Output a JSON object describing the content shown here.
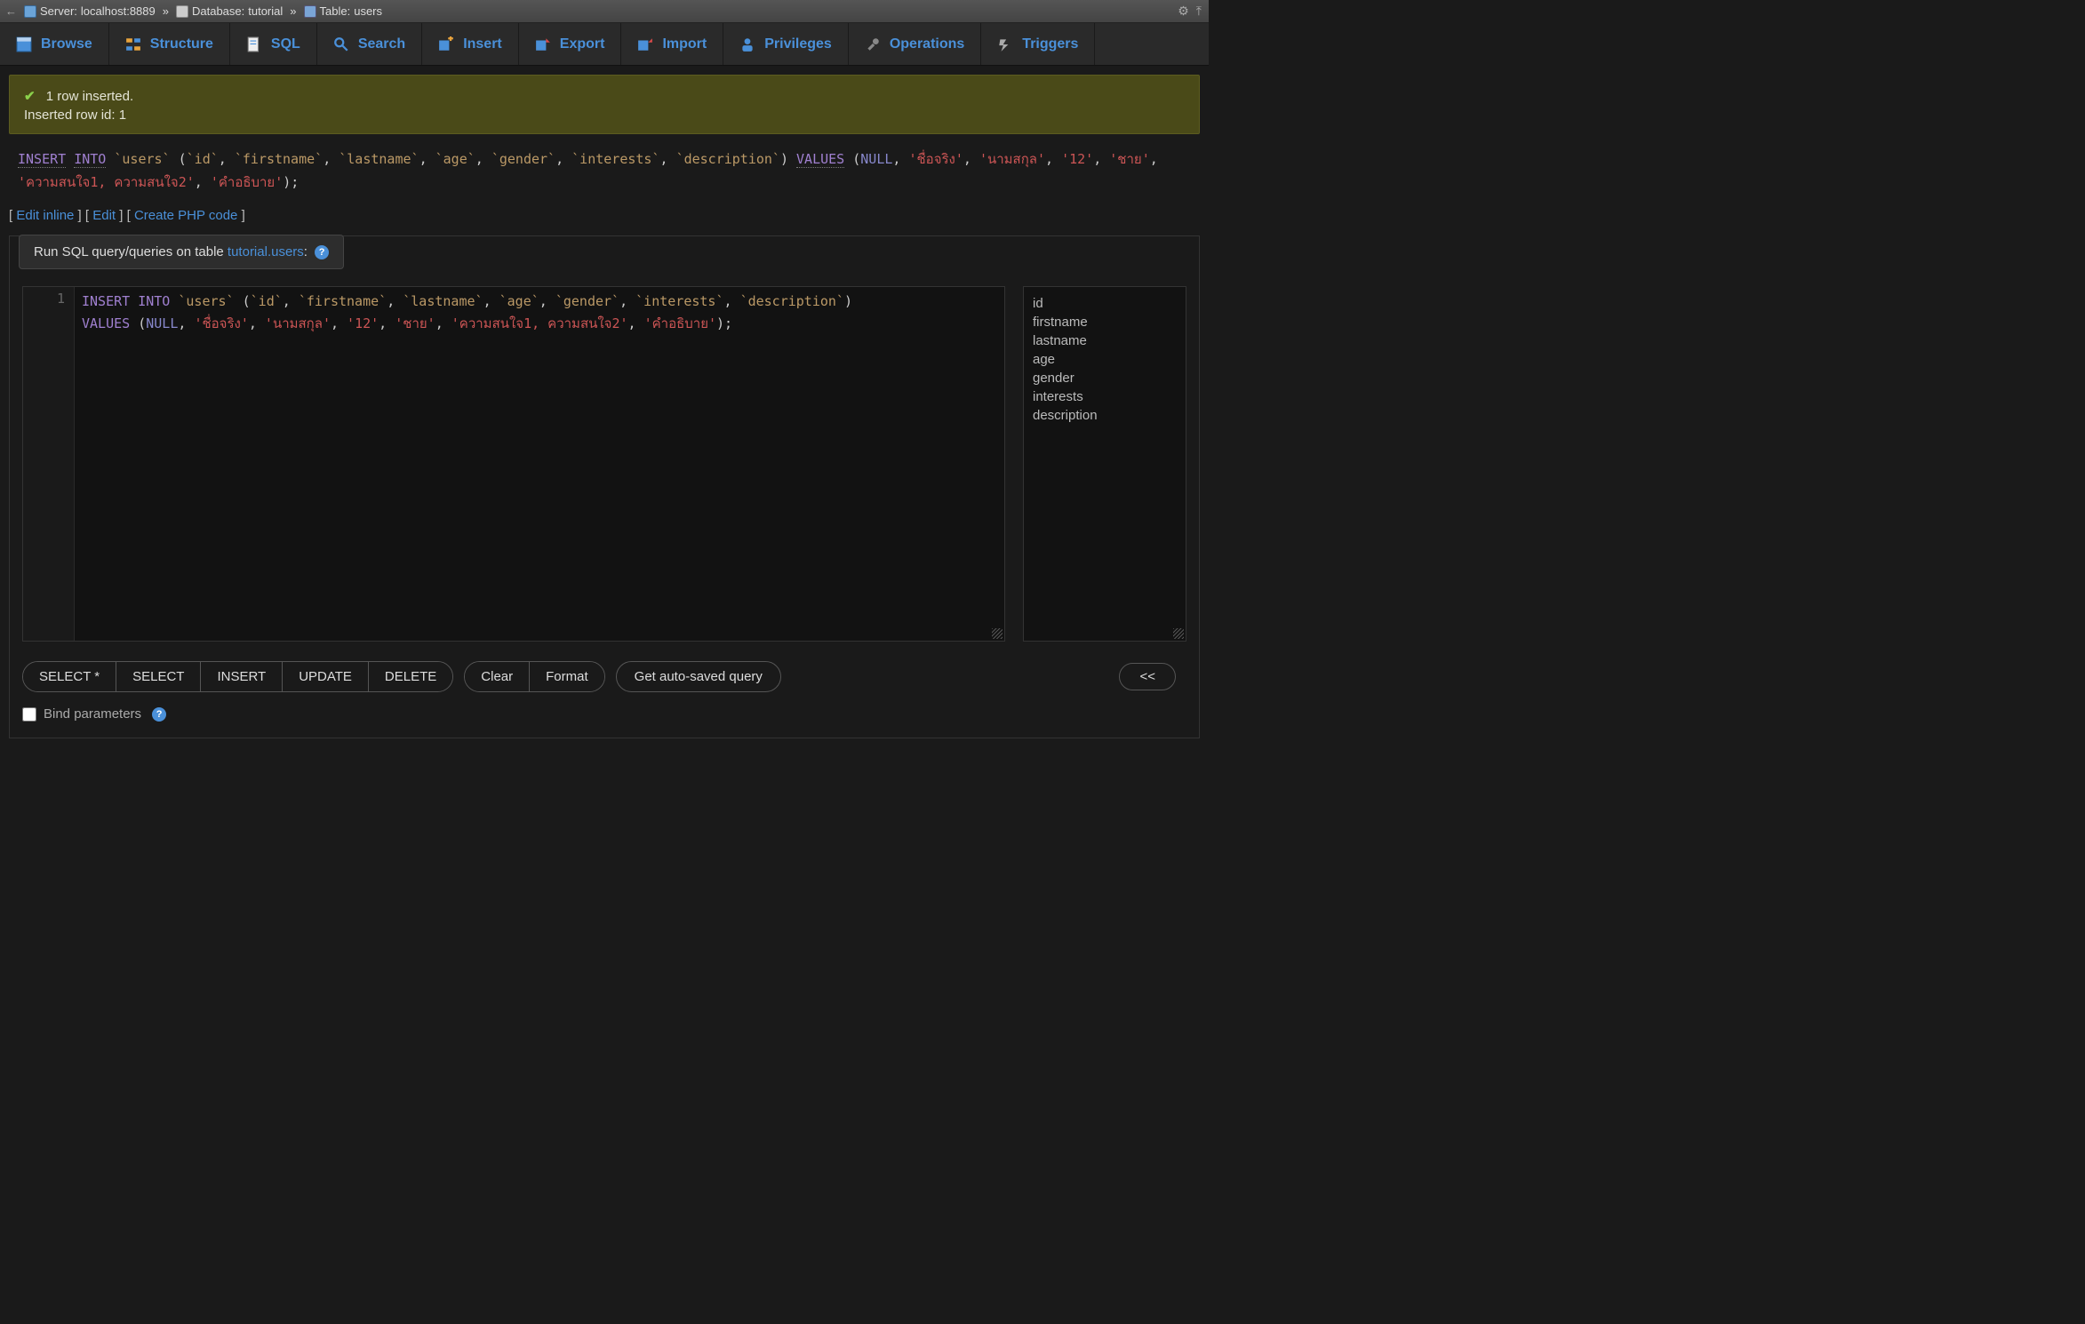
{
  "breadcrumb": {
    "server_label": "Server:",
    "server_value": "localhost:8889",
    "database_label": "Database:",
    "database_value": "tutorial",
    "table_label": "Table:",
    "table_value": "users"
  },
  "tabs": {
    "browse": "Browse",
    "structure": "Structure",
    "sql": "SQL",
    "search": "Search",
    "insert": "Insert",
    "export": "Export",
    "import": "Import",
    "privileges": "Privileges",
    "operations": "Operations",
    "triggers": "Triggers"
  },
  "notice": {
    "line1": "1 row inserted.",
    "line2": "Inserted row id: 1"
  },
  "executed_sql": {
    "tokens": [
      {
        "t": "kw-d",
        "v": "INSERT"
      },
      {
        "t": "sp",
        "v": " "
      },
      {
        "t": "kw-d",
        "v": "INTO"
      },
      {
        "t": "sp",
        "v": " "
      },
      {
        "t": "bt",
        "v": "`users`"
      },
      {
        "t": "sp",
        "v": " "
      },
      {
        "t": "p",
        "v": "("
      },
      {
        "t": "bt",
        "v": "`id`"
      },
      {
        "t": "p",
        "v": ", "
      },
      {
        "t": "bt",
        "v": "`firstname`"
      },
      {
        "t": "p",
        "v": ", "
      },
      {
        "t": "bt",
        "v": "`lastname`"
      },
      {
        "t": "p",
        "v": ", "
      },
      {
        "t": "bt",
        "v": "`age`"
      },
      {
        "t": "p",
        "v": ", "
      },
      {
        "t": "bt",
        "v": "`gender`"
      },
      {
        "t": "p",
        "v": ", "
      },
      {
        "t": "bt",
        "v": "`interests`"
      },
      {
        "t": "p",
        "v": ", "
      },
      {
        "t": "bt",
        "v": "`description`"
      },
      {
        "t": "p",
        "v": ") "
      },
      {
        "t": "kw-d",
        "v": "VALUES"
      },
      {
        "t": "sp",
        "v": " "
      },
      {
        "t": "p",
        "v": "("
      },
      {
        "t": "null",
        "v": "NULL"
      },
      {
        "t": "p",
        "v": ", "
      },
      {
        "t": "str",
        "v": "'ชื่อจริง'"
      },
      {
        "t": "p",
        "v": ", "
      },
      {
        "t": "str",
        "v": "'นามสกุล'"
      },
      {
        "t": "p",
        "v": ", "
      },
      {
        "t": "str",
        "v": "'12'"
      },
      {
        "t": "p",
        "v": ", "
      },
      {
        "t": "str",
        "v": "'ชาย'"
      },
      {
        "t": "p",
        "v": ", "
      },
      {
        "t": "str",
        "v": "'ความสนใจ1, ความสนใจ2'"
      },
      {
        "t": "p",
        "v": ", "
      },
      {
        "t": "str",
        "v": "'คำอธิบาย'"
      },
      {
        "t": "p",
        "v": ");"
      }
    ]
  },
  "action_links": {
    "edit_inline": "Edit inline",
    "edit": "Edit",
    "create_php": "Create PHP code"
  },
  "query_panel": {
    "header_prefix": "Run SQL query/queries on table ",
    "header_target": "tutorial.users",
    "header_suffix": ":"
  },
  "editor": {
    "line_no": "1",
    "tokens": [
      {
        "t": "kw",
        "v": "INSERT"
      },
      {
        "t": "sp",
        "v": " "
      },
      {
        "t": "kw",
        "v": "INTO"
      },
      {
        "t": "sp",
        "v": " "
      },
      {
        "t": "bt",
        "v": "`users`"
      },
      {
        "t": "sp",
        "v": " "
      },
      {
        "t": "p",
        "v": "("
      },
      {
        "t": "bt",
        "v": "`id`"
      },
      {
        "t": "p",
        "v": ", "
      },
      {
        "t": "bt",
        "v": "`firstname`"
      },
      {
        "t": "p",
        "v": ", "
      },
      {
        "t": "bt",
        "v": "`lastname`"
      },
      {
        "t": "p",
        "v": ", "
      },
      {
        "t": "bt",
        "v": "`age`"
      },
      {
        "t": "p",
        "v": ", "
      },
      {
        "t": "bt",
        "v": "`gender`"
      },
      {
        "t": "p",
        "v": ", "
      },
      {
        "t": "bt",
        "v": "`interests`"
      },
      {
        "t": "p",
        "v": ", "
      },
      {
        "t": "bt",
        "v": "`description`"
      },
      {
        "t": "p",
        "v": ") "
      },
      {
        "t": "nl",
        "v": "\n"
      },
      {
        "t": "kw",
        "v": "VALUES"
      },
      {
        "t": "sp",
        "v": " "
      },
      {
        "t": "p",
        "v": "("
      },
      {
        "t": "null",
        "v": "NULL"
      },
      {
        "t": "p",
        "v": ", "
      },
      {
        "t": "str",
        "v": "'ชื่อจริง'"
      },
      {
        "t": "p",
        "v": ", "
      },
      {
        "t": "str",
        "v": "'นามสกุล'"
      },
      {
        "t": "p",
        "v": ", "
      },
      {
        "t": "str",
        "v": "'12'"
      },
      {
        "t": "p",
        "v": ", "
      },
      {
        "t": "str",
        "v": "'ชาย'"
      },
      {
        "t": "p",
        "v": ", "
      },
      {
        "t": "str",
        "v": "'ความสนใจ1, ความสนใจ2'"
      },
      {
        "t": "p",
        "v": ", "
      },
      {
        "t": "str",
        "v": "'คำอธิบาย'"
      },
      {
        "t": "p",
        "v": ");"
      }
    ]
  },
  "columns": [
    "id",
    "firstname",
    "lastname",
    "age",
    "gender",
    "interests",
    "description"
  ],
  "buttons": {
    "select_star": "SELECT *",
    "select": "SELECT",
    "insert": "INSERT",
    "update": "UPDATE",
    "delete": "DELETE",
    "clear": "Clear",
    "format": "Format",
    "autosaved": "Get auto-saved query",
    "columns_toggle": "<<"
  },
  "bind": {
    "label": "Bind parameters"
  }
}
